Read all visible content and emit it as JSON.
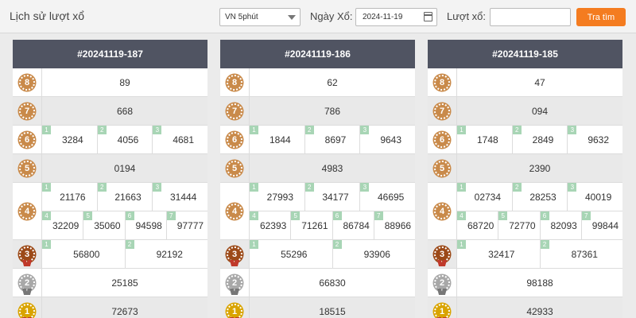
{
  "topbar": {
    "title": "Lịch sử lượt xổ",
    "select_value": "VN 5phút",
    "date_label": "Ngày Xổ:",
    "date_value": "2024-11-19",
    "turn_label": "Lượt xổ:",
    "turn_value": "",
    "search_button": "Tra tìm"
  },
  "panels": [
    {
      "title": "#20241119-187",
      "p8": "89",
      "p7": "668",
      "p6": [
        {
          "i": "1",
          "v": "3284"
        },
        {
          "i": "2",
          "v": "4056"
        },
        {
          "i": "3",
          "v": "4681"
        }
      ],
      "p5": "0194",
      "p4a": [
        {
          "i": "1",
          "v": "21176"
        },
        {
          "i": "2",
          "v": "21663"
        },
        {
          "i": "3",
          "v": "31444"
        }
      ],
      "p4b": [
        {
          "i": "4",
          "v": "32209"
        },
        {
          "i": "5",
          "v": "35060"
        },
        {
          "i": "6",
          "v": "94598"
        },
        {
          "i": "7",
          "v": "97777"
        }
      ],
      "p3": [
        {
          "i": "1",
          "v": "56800"
        },
        {
          "i": "2",
          "v": "92192"
        }
      ],
      "p2": "25185",
      "p1": "72673"
    },
    {
      "title": "#20241119-186",
      "p8": "62",
      "p7": "786",
      "p6": [
        {
          "i": "1",
          "v": "1844"
        },
        {
          "i": "2",
          "v": "8697"
        },
        {
          "i": "3",
          "v": "9643"
        }
      ],
      "p5": "4983",
      "p4a": [
        {
          "i": "1",
          "v": "27993"
        },
        {
          "i": "2",
          "v": "34177"
        },
        {
          "i": "3",
          "v": "46695"
        }
      ],
      "p4b": [
        {
          "i": "4",
          "v": "62393"
        },
        {
          "i": "5",
          "v": "71261"
        },
        {
          "i": "6",
          "v": "86784"
        },
        {
          "i": "7",
          "v": "88966"
        }
      ],
      "p3": [
        {
          "i": "1",
          "v": "55296"
        },
        {
          "i": "2",
          "v": "93906"
        }
      ],
      "p2": "66830",
      "p1": "18515"
    },
    {
      "title": "#20241119-185",
      "p8": "47",
      "p7": "094",
      "p6": [
        {
          "i": "1",
          "v": "1748"
        },
        {
          "i": "2",
          "v": "2849"
        },
        {
          "i": "3",
          "v": "9632"
        }
      ],
      "p5": "2390",
      "p4a": [
        {
          "i": "1",
          "v": "02734"
        },
        {
          "i": "2",
          "v": "28253"
        },
        {
          "i": "3",
          "v": "40019"
        }
      ],
      "p4b": [
        {
          "i": "4",
          "v": "68720"
        },
        {
          "i": "5",
          "v": "72770"
        },
        {
          "i": "6",
          "v": "82093"
        },
        {
          "i": "7",
          "v": "99844"
        }
      ],
      "p3": [
        {
          "i": "1",
          "v": "32417"
        },
        {
          "i": "2",
          "v": "87361"
        }
      ],
      "p2": "98188",
      "p1": "42933"
    }
  ],
  "medals": {
    "m8": "8",
    "m7": "7",
    "m6": "6",
    "m5": "5",
    "m4": "4",
    "m3": "3",
    "m2": "2",
    "m1": "1"
  },
  "colors": {
    "accent": "#f47c20",
    "header": "#505462",
    "index_badge": "#a8d5b5"
  }
}
